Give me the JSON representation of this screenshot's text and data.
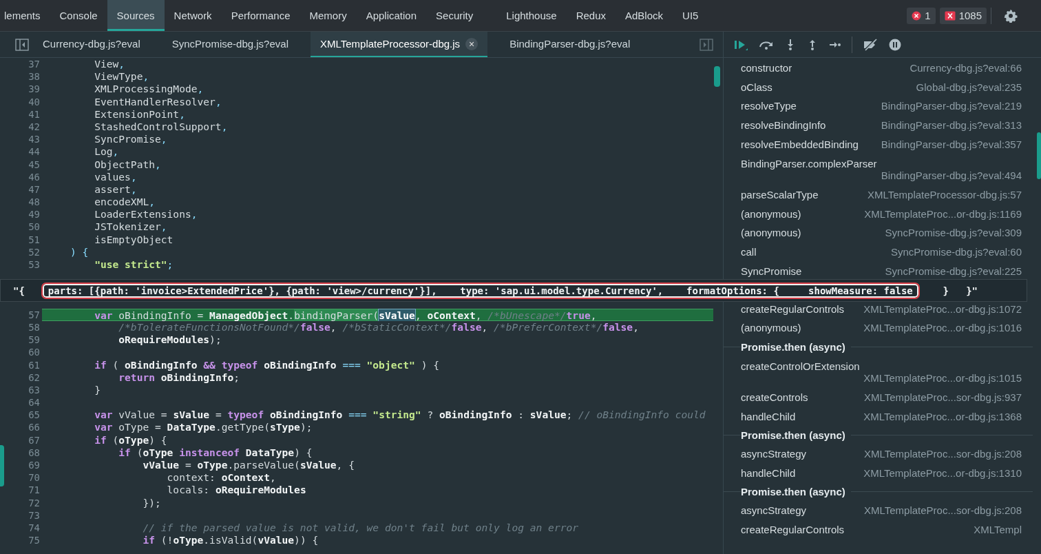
{
  "devtools_tabs": [
    {
      "label": "lements",
      "selected": false
    },
    {
      "label": "Console",
      "selected": false
    },
    {
      "label": "Sources",
      "selected": true
    },
    {
      "label": "Network",
      "selected": false
    },
    {
      "label": "Performance",
      "selected": false
    },
    {
      "label": "Memory",
      "selected": false
    },
    {
      "label": "Application",
      "selected": false
    },
    {
      "label": "Security",
      "selected": false
    },
    {
      "label": "Lighthouse",
      "selected": false
    },
    {
      "label": "Redux",
      "selected": false
    },
    {
      "label": "AdBlock",
      "selected": false
    },
    {
      "label": "UI5",
      "selected": false
    }
  ],
  "error_count": "1",
  "warning_count": "1085",
  "file_tabs": [
    {
      "label": "Currency-dbg.js?eval",
      "selected": false
    },
    {
      "label": "SyncPromise-dbg.js?eval",
      "selected": false
    },
    {
      "label": "XMLTemplateProcessor-dbg.js",
      "selected": true
    },
    {
      "label": "BindingParser-dbg.js?eval",
      "selected": false
    }
  ],
  "close_label": "×",
  "code_lines_above": [
    {
      "n": "37",
      "current": false,
      "tokens": [
        {
          "kind": "plain",
          "text": "    View"
        },
        {
          "kind": "punct",
          "text": ","
        }
      ]
    },
    {
      "n": "38",
      "current": false,
      "tokens": [
        {
          "kind": "plain",
          "text": "    ViewType"
        },
        {
          "kind": "punct",
          "text": ","
        }
      ]
    },
    {
      "n": "39",
      "current": false,
      "tokens": [
        {
          "kind": "plain",
          "text": "    XMLProcessingMode"
        },
        {
          "kind": "punct",
          "text": ","
        }
      ]
    },
    {
      "n": "40",
      "current": false,
      "tokens": [
        {
          "kind": "plain",
          "text": "    EventHandlerResolver"
        },
        {
          "kind": "punct",
          "text": ","
        }
      ]
    },
    {
      "n": "41",
      "current": false,
      "tokens": [
        {
          "kind": "plain",
          "text": "    ExtensionPoint"
        },
        {
          "kind": "punct",
          "text": ","
        }
      ]
    },
    {
      "n": "42",
      "current": false,
      "tokens": [
        {
          "kind": "plain",
          "text": "    StashedControlSupport"
        },
        {
          "kind": "punct",
          "text": ","
        }
      ]
    },
    {
      "n": "43",
      "current": false,
      "tokens": [
        {
          "kind": "plain",
          "text": "    SyncPromise"
        },
        {
          "kind": "punct",
          "text": ","
        }
      ]
    },
    {
      "n": "44",
      "current": false,
      "tokens": [
        {
          "kind": "plain",
          "text": "    Log"
        },
        {
          "kind": "punct",
          "text": ","
        }
      ]
    },
    {
      "n": "45",
      "current": false,
      "tokens": [
        {
          "kind": "plain",
          "text": "    ObjectPath"
        },
        {
          "kind": "punct",
          "text": ","
        }
      ]
    },
    {
      "n": "46",
      "current": false,
      "tokens": [
        {
          "kind": "plain",
          "text": "    values"
        },
        {
          "kind": "punct",
          "text": ","
        }
      ]
    },
    {
      "n": "47",
      "current": false,
      "tokens": [
        {
          "kind": "plain",
          "text": "    assert"
        },
        {
          "kind": "punct",
          "text": ","
        }
      ]
    },
    {
      "n": "48",
      "current": false,
      "tokens": [
        {
          "kind": "plain",
          "text": "    encodeXML"
        },
        {
          "kind": "punct",
          "text": ","
        }
      ]
    },
    {
      "n": "49",
      "current": false,
      "tokens": [
        {
          "kind": "plain",
          "text": "    LoaderExtensions"
        },
        {
          "kind": "punct",
          "text": ","
        }
      ]
    },
    {
      "n": "50",
      "current": false,
      "tokens": [
        {
          "kind": "plain",
          "text": "    JSTokenizer"
        },
        {
          "kind": "punct",
          "text": ","
        }
      ]
    },
    {
      "n": "51",
      "current": false,
      "tokens": [
        {
          "kind": "plain",
          "text": "    isEmptyObject"
        }
      ]
    },
    {
      "n": "52",
      "current": false,
      "tokens": [
        {
          "kind": "punct",
          "text": ") {"
        }
      ]
    },
    {
      "n": "53",
      "current": false,
      "tokens": [
        {
          "kind": "string",
          "text": "    \"use strict\""
        },
        {
          "kind": "punct",
          "text": ";"
        }
      ]
    }
  ],
  "tooltip": {
    "prefix": "\"{",
    "highlighted": "parts: [{path: 'invoice>ExtendedPrice'}, {path: 'view>/currency'}],    type: 'sap.ui.model.type.Currency',    formatOptions: {     showMeasure: false",
    "suffix": "    }   }\""
  },
  "code_lines_below": [
    {
      "n": "57",
      "current": true,
      "tokens": [
        {
          "kind": "keyword",
          "text": "    var"
        },
        {
          "kind": "plain",
          "text": " oBindingInfo = "
        },
        {
          "kind": "ident",
          "text": "ManagedObject"
        },
        {
          "kind": "plain",
          "text": "."
        },
        {
          "kind": "call",
          "text": "bindingParser("
        },
        {
          "kind": "selection",
          "text": "sValue"
        },
        {
          "kind": "plain",
          "text": ", "
        },
        {
          "kind": "ident",
          "text": "oContext"
        },
        {
          "kind": "plain",
          "text": ", "
        },
        {
          "kind": "comment",
          "text": "/*bUnescape*/"
        },
        {
          "kind": "keyword",
          "text": "true"
        },
        {
          "kind": "plain",
          "text": ","
        }
      ]
    },
    {
      "n": "58",
      "current": false,
      "tokens": [
        {
          "kind": "comment",
          "text": "        /*bTolerateFunctionsNotFound*/"
        },
        {
          "kind": "keyword",
          "text": "false"
        },
        {
          "kind": "plain",
          "text": ", "
        },
        {
          "kind": "comment",
          "text": "/*bStaticContext*/"
        },
        {
          "kind": "keyword",
          "text": "false"
        },
        {
          "kind": "plain",
          "text": ", "
        },
        {
          "kind": "comment",
          "text": "/*bPreferContext*/"
        },
        {
          "kind": "keyword",
          "text": "false"
        },
        {
          "kind": "plain",
          "text": ","
        }
      ]
    },
    {
      "n": "59",
      "current": false,
      "tokens": [
        {
          "kind": "ident",
          "text": "        oRequireModules"
        },
        {
          "kind": "plain",
          "text": ");"
        }
      ]
    },
    {
      "n": "60",
      "current": false
    },
    {
      "n": "61",
      "current": false,
      "tokens": [
        {
          "kind": "keyword",
          "text": "    if"
        },
        {
          "kind": "plain",
          "text": " ( "
        },
        {
          "kind": "ident",
          "text": "oBindingInfo"
        },
        {
          "kind": "keyword",
          "text": " && typeof "
        },
        {
          "kind": "ident",
          "text": "oBindingInfo"
        },
        {
          "kind": "punct",
          "text": " === "
        },
        {
          "kind": "string",
          "text": "\"object\""
        },
        {
          "kind": "plain",
          "text": " ) {"
        }
      ]
    },
    {
      "n": "62",
      "current": false,
      "tokens": [
        {
          "kind": "keyword",
          "text": "        return"
        },
        {
          "kind": "ident",
          "text": " oBindingInfo"
        },
        {
          "kind": "plain",
          "text": ";"
        }
      ]
    },
    {
      "n": "63",
      "current": false,
      "tokens": [
        {
          "kind": "plain",
          "text": "    }"
        }
      ]
    },
    {
      "n": "64",
      "current": false
    },
    {
      "n": "65",
      "current": false,
      "tokens": [
        {
          "kind": "keyword",
          "text": "    var"
        },
        {
          "kind": "plain",
          "text": " vValue = "
        },
        {
          "kind": "ident",
          "text": "sValue"
        },
        {
          "kind": "plain",
          "text": " = "
        },
        {
          "kind": "keyword",
          "text": "typeof"
        },
        {
          "kind": "ident",
          "text": " oBindingInfo"
        },
        {
          "kind": "punct",
          "text": " === "
        },
        {
          "kind": "string",
          "text": "\"string\""
        },
        {
          "kind": "plain",
          "text": " ? "
        },
        {
          "kind": "ident",
          "text": "oBindingInfo"
        },
        {
          "kind": "plain",
          "text": " : "
        },
        {
          "kind": "ident",
          "text": "sValue"
        },
        {
          "kind": "plain",
          "text": "; "
        },
        {
          "kind": "comment",
          "text": "// oBindingInfo could"
        }
      ]
    },
    {
      "n": "66",
      "current": false,
      "tokens": [
        {
          "kind": "keyword",
          "text": "    var"
        },
        {
          "kind": "plain",
          "text": " oType = "
        },
        {
          "kind": "ident",
          "text": "DataType"
        },
        {
          "kind": "plain",
          "text": ".getType("
        },
        {
          "kind": "ident",
          "text": "sType"
        },
        {
          "kind": "plain",
          "text": ");"
        }
      ]
    },
    {
      "n": "67",
      "current": false,
      "tokens": [
        {
          "kind": "keyword",
          "text": "    if"
        },
        {
          "kind": "plain",
          "text": " ("
        },
        {
          "kind": "ident",
          "text": "oType"
        },
        {
          "kind": "plain",
          "text": ") {"
        }
      ]
    },
    {
      "n": "68",
      "current": false,
      "tokens": [
        {
          "kind": "keyword",
          "text": "        if"
        },
        {
          "kind": "plain",
          "text": " ("
        },
        {
          "kind": "ident",
          "text": "oType"
        },
        {
          "kind": "keyword",
          "text": " instanceof "
        },
        {
          "kind": "ident",
          "text": "DataType"
        },
        {
          "kind": "plain",
          "text": ") {"
        }
      ]
    },
    {
      "n": "69",
      "current": false,
      "tokens": [
        {
          "kind": "ident",
          "text": "            vValue"
        },
        {
          "kind": "plain",
          "text": " = "
        },
        {
          "kind": "ident",
          "text": "oType"
        },
        {
          "kind": "plain",
          "text": ".parseValue("
        },
        {
          "kind": "ident",
          "text": "sValue"
        },
        {
          "kind": "plain",
          "text": ", {"
        }
      ]
    },
    {
      "n": "70",
      "current": false,
      "tokens": [
        {
          "kind": "plain",
          "text": "                context: "
        },
        {
          "kind": "ident",
          "text": "oContext"
        },
        {
          "kind": "plain",
          "text": ","
        }
      ]
    },
    {
      "n": "71",
      "current": false,
      "tokens": [
        {
          "kind": "plain",
          "text": "                locals: "
        },
        {
          "kind": "ident",
          "text": "oRequireModules"
        }
      ]
    },
    {
      "n": "72",
      "current": false,
      "tokens": [
        {
          "kind": "plain",
          "text": "            });"
        }
      ]
    },
    {
      "n": "73",
      "current": false
    },
    {
      "n": "74",
      "current": false,
      "tokens": [
        {
          "kind": "comment",
          "text": "            // if the parsed value is not valid, we don't fail but only log an error"
        }
      ]
    },
    {
      "n": "75",
      "current": false,
      "tokens": [
        {
          "kind": "keyword",
          "text": "            if"
        },
        {
          "kind": "plain",
          "text": " (!"
        },
        {
          "kind": "ident",
          "text": "oType"
        },
        {
          "kind": "plain",
          "text": ".isValid("
        },
        {
          "kind": "ident",
          "text": "vValue"
        },
        {
          "kind": "plain",
          "text": ")) {"
        }
      ]
    }
  ],
  "call_stack_above": [
    {
      "kind": "frame",
      "name": "constructor",
      "location": "Currency-dbg.js?eval:66",
      "wrapped": false
    },
    {
      "kind": "frame",
      "name": "oClass",
      "location": "Global-dbg.js?eval:235",
      "wrapped": false
    },
    {
      "kind": "frame",
      "name": "resolveType",
      "location": "BindingParser-dbg.js?eval:219",
      "wrapped": false
    },
    {
      "kind": "frame",
      "name": "resolveBindingInfo",
      "location": "BindingParser-dbg.js?eval:313",
      "wrapped": false
    },
    {
      "kind": "frame",
      "name": "resolveEmbeddedBinding",
      "location": "BindingParser-dbg.js?eval:357",
      "wrapped": false
    },
    {
      "kind": "frame",
      "name": "BindingParser.complexParser",
      "location": "BindingParser-dbg.js?eval:494",
      "wrapped": true
    },
    {
      "kind": "frame",
      "name": "parseScalarType",
      "location": "XMLTemplateProcessor-dbg.js:57",
      "wrapped": false
    },
    {
      "kind": "frame",
      "name": "(anonymous)",
      "location": "XMLTemplateProc...or-dbg.js:1169",
      "wrapped": false
    },
    {
      "kind": "frame",
      "name": "(anonymous)",
      "location": "SyncPromise-dbg.js?eval:309",
      "wrapped": false
    },
    {
      "kind": "frame",
      "name": "call",
      "location": "SyncPromise-dbg.js?eval:60",
      "wrapped": false
    },
    {
      "kind": "frame",
      "name": "SyncPromise",
      "location": "SyncPromise-dbg.js?eval:225",
      "wrapped": false
    }
  ],
  "call_stack_below": [
    {
      "kind": "frame",
      "name": "createRegularControls",
      "location": "XMLTemplateProc...or-dbg.js:1072",
      "wrapped": false
    },
    {
      "kind": "frame",
      "name": "(anonymous)",
      "location": "XMLTemplateProc...or-dbg.js:1016",
      "wrapped": false
    },
    {
      "kind": "async",
      "label": "Promise.then (async)"
    },
    {
      "kind": "frame",
      "name": "createControlOrExtension",
      "location": "XMLTemplateProc...or-dbg.js:1015",
      "wrapped": true
    },
    {
      "kind": "frame",
      "name": "createControls",
      "location": "XMLTemplateProc...sor-dbg.js:937",
      "wrapped": false
    },
    {
      "kind": "frame",
      "name": "handleChild",
      "location": "XMLTemplateProc...or-dbg.js:1368",
      "wrapped": false
    },
    {
      "kind": "async",
      "label": "Promise.then (async)"
    },
    {
      "kind": "frame",
      "name": "asyncStrategy",
      "location": "XMLTemplateProc...sor-dbg.js:208",
      "wrapped": false
    },
    {
      "kind": "frame",
      "name": "handleChild",
      "location": "XMLTemplateProc...or-dbg.js:1310",
      "wrapped": false
    },
    {
      "kind": "async",
      "label": "Promise.then (async)"
    },
    {
      "kind": "frame",
      "name": "asyncStrategy",
      "location": "XMLTemplateProc...sor-dbg.js:208",
      "wrapped": false
    },
    {
      "kind": "frame",
      "name": "createRegularControls",
      "location": "XMLTempl",
      "wrapped": false
    }
  ]
}
